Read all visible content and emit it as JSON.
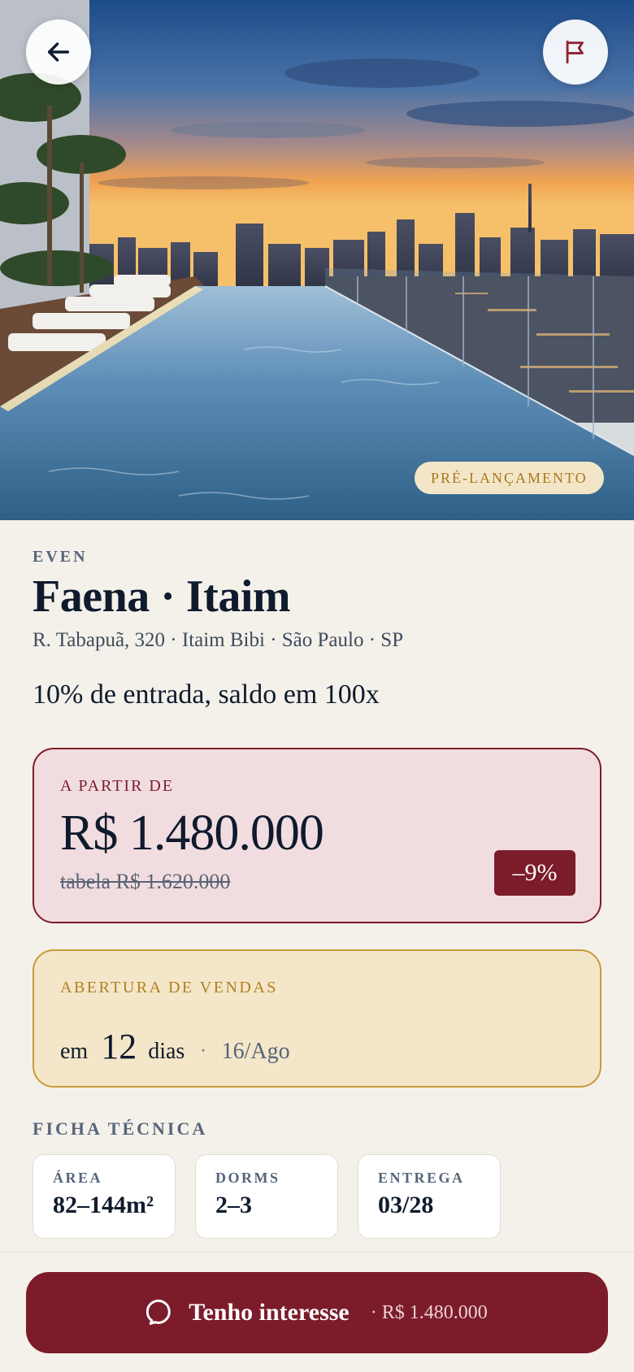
{
  "hero": {
    "status_badge": "PRÉ-LANÇAMENTO"
  },
  "listing": {
    "developer": "EVEN",
    "title": "Faena · Itaim",
    "address": "R. Tabapuã, 320 · Itaim Bibi · São Paulo · SP",
    "payment_terms": "10% de entrada, saldo em 100x"
  },
  "price": {
    "label": "A PARTIR DE",
    "value": "R$ 1.480.000",
    "old": "tabela R$ 1.620.000",
    "discount": "–9%"
  },
  "sales": {
    "label": "ABERTURA DE VENDAS",
    "prefix": "em",
    "days": "12",
    "unit": "dias",
    "separator": "·",
    "date": "16/Ago"
  },
  "specs": {
    "heading": "FICHA TÉCNICA",
    "items": [
      {
        "label": "ÁREA",
        "value": "82–144m²"
      },
      {
        "label": "DORMS",
        "value": "2–3"
      },
      {
        "label": "ENTREGA",
        "value": "03/28"
      }
    ]
  },
  "cta": {
    "icon": "chat-bubble-icon",
    "label": "Tenho interesse",
    "separator": "·",
    "price": "R$ 1.480.000"
  },
  "icons": {
    "back": "arrow-left-icon",
    "report": "flag-icon"
  },
  "colors": {
    "background": "#f4f1ea",
    "brand": "#7c1c2a",
    "gold": "#c89a3a",
    "ink": "#0f1b2d"
  }
}
